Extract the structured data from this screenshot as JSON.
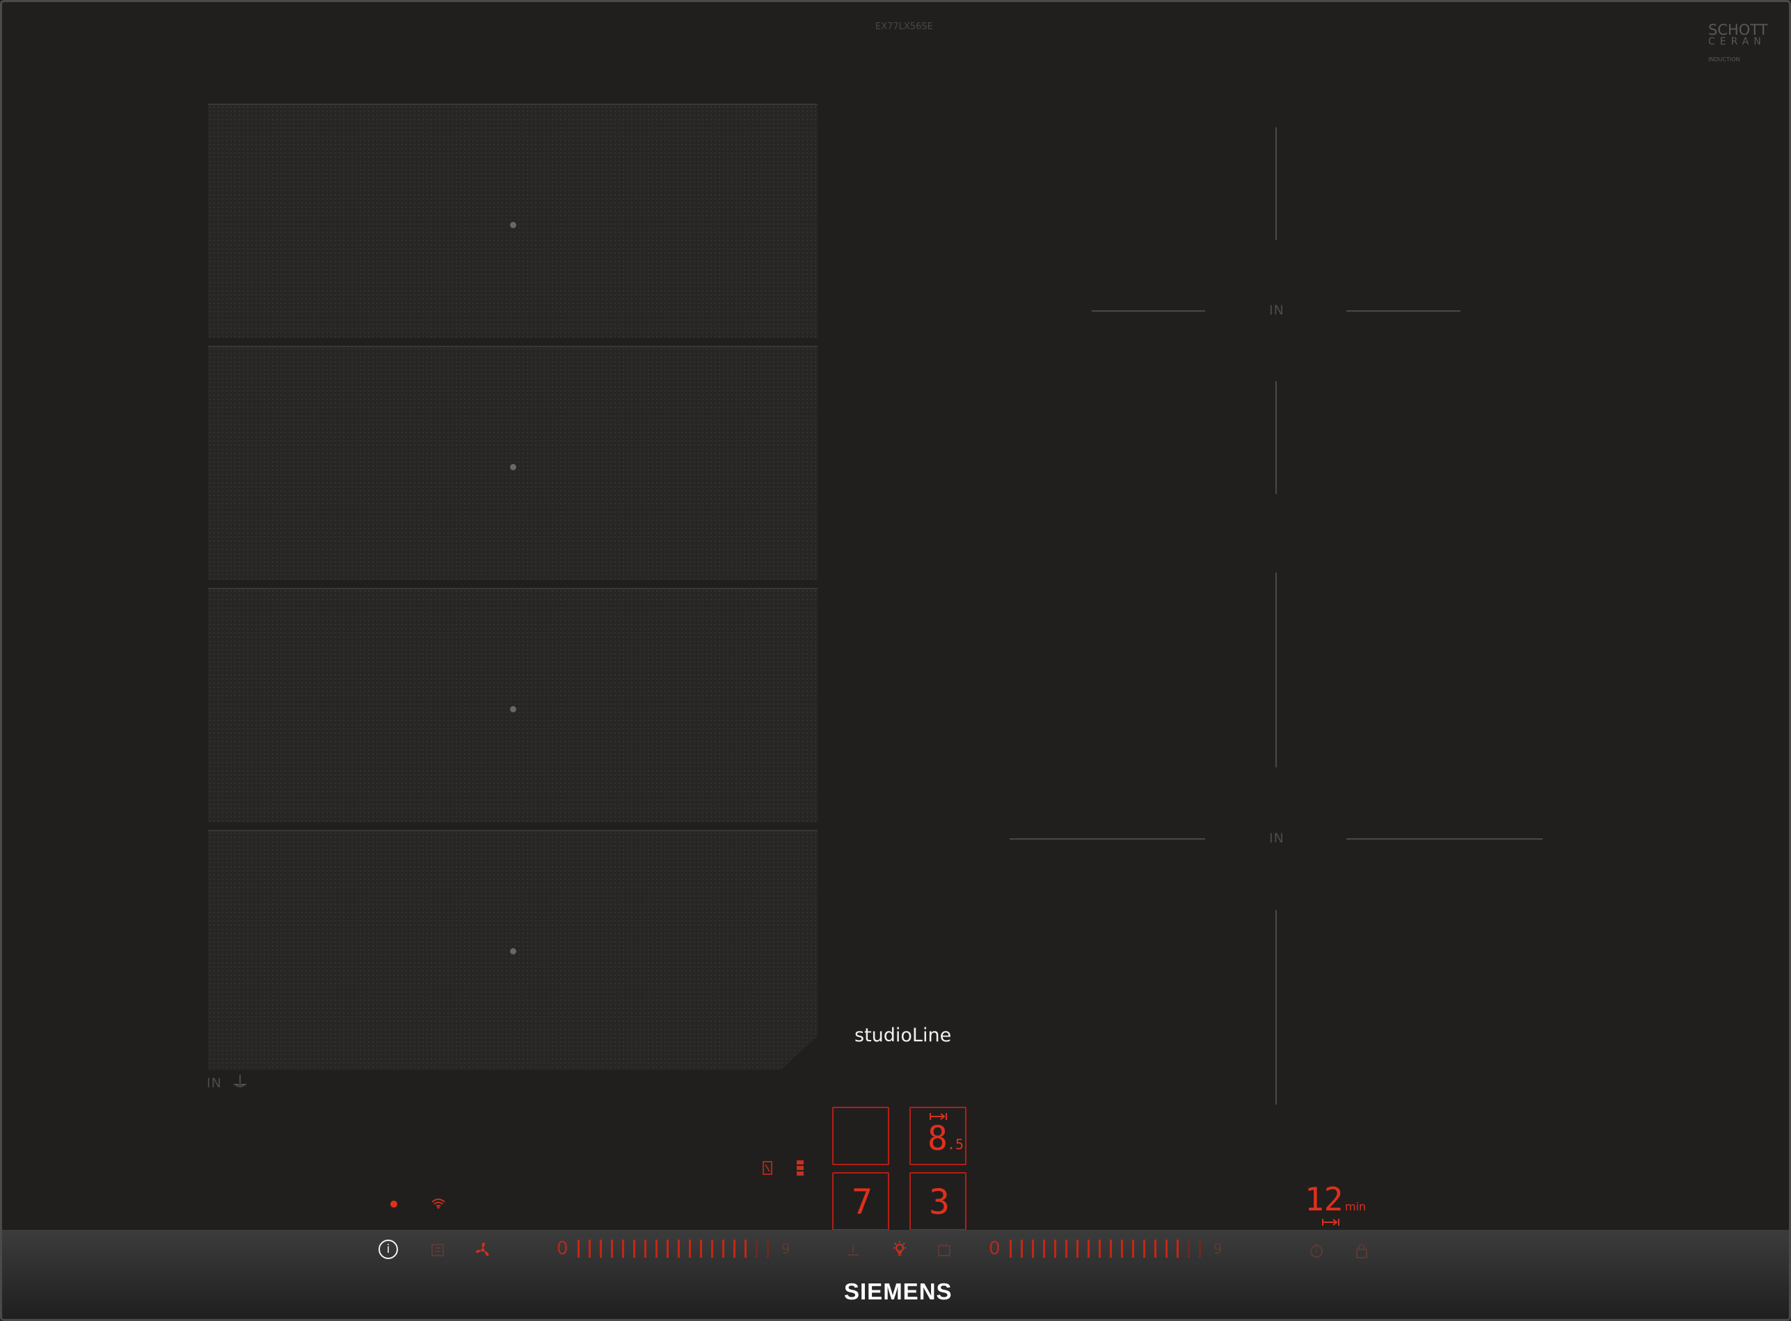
{
  "product": {
    "model_code": "EX77LX56SE",
    "glass_brand_line1": "SCHOTT",
    "glass_brand_line2": "CERAN",
    "glass_brand_sub": "INDUCTION",
    "series_label": "studioLine",
    "brand": "SIEMENS"
  },
  "cooking_zones": {
    "flex_label": "IN",
    "right_zone_label_top": "IN",
    "right_zone_label_bottom": "IN"
  },
  "displays": {
    "zone_top_left_value": "",
    "zone_top_right_value": "8",
    "zone_top_right_decimal": ".5",
    "zone_bottom_left_value": "7",
    "zone_bottom_right_value": "3",
    "timer_value": "12",
    "timer_unit": "min"
  },
  "controls": {
    "slider_left_start": "0",
    "slider_left_end": "9",
    "slider_right_start": "0",
    "slider_right_end": "9",
    "info_symbol": "i"
  },
  "colors": {
    "glass": "#201f1d",
    "indicator_red": "#e0301c",
    "frame": "#4a4a4a"
  },
  "icons": [
    "power-indicator-icon",
    "wifi-icon",
    "info-icon",
    "extractor-fan-icon",
    "boost-icon",
    "light-icon",
    "timer-icon"
  ]
}
